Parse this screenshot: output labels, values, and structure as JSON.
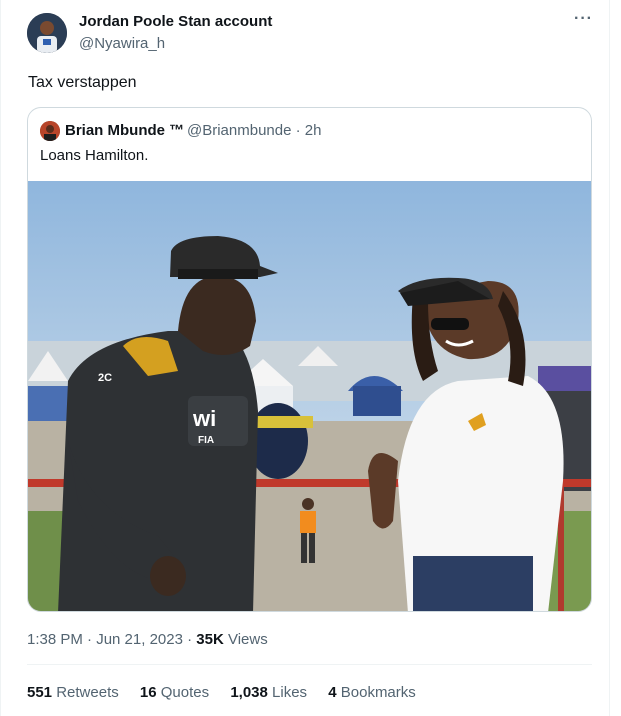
{
  "tweet": {
    "author_name": "Jordan Poole Stan account",
    "author_handle": "@Nyawira_h",
    "more_icon": "more-icon",
    "text": "Tax verstappen",
    "timestamp": "1:38 PM · Jun 21, 2023 · ",
    "views_count": "35K",
    "views_label": " Views"
  },
  "quote": {
    "author_name": "Brian Mbunde ™",
    "author_handle": "@Brianmbunde · 2h",
    "text": "Loans Hamilton.",
    "photo_texts": {
      "left_suit_logo": "wi",
      "left_suit_fia": "FIA",
      "left_suit_badge": "2C"
    }
  },
  "stats": [
    {
      "count": "551",
      "label": "Retweets"
    },
    {
      "count": "16",
      "label": "Quotes"
    },
    {
      "count": "1,038",
      "label": "Likes"
    },
    {
      "count": "4",
      "label": "Bookmarks"
    }
  ],
  "colors": {
    "secondary_text": "#536471",
    "border": "#cfd9de",
    "divider": "#eff3f4"
  }
}
